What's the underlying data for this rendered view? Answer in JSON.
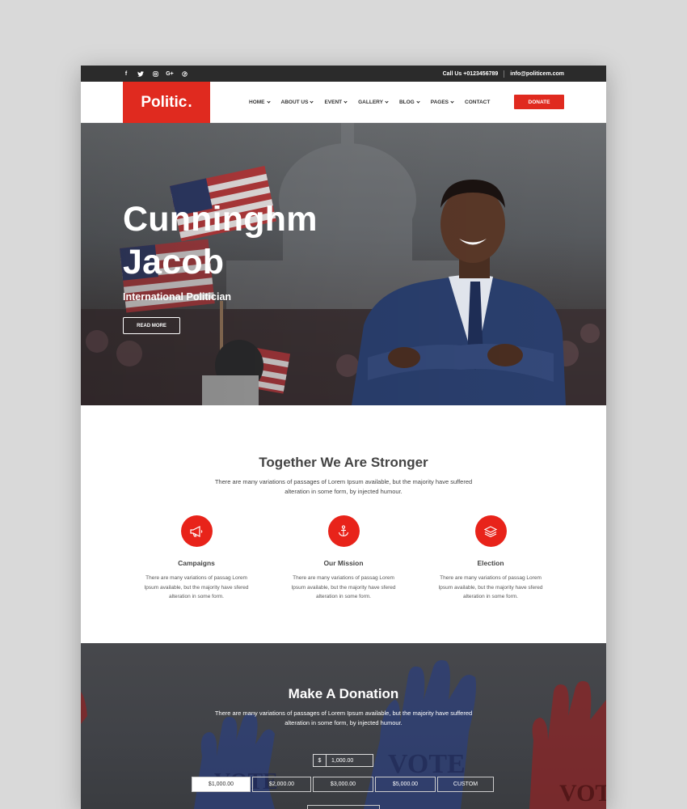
{
  "topbar": {
    "socials": [
      {
        "icon": "facebook-icon",
        "glyph": "f"
      },
      {
        "icon": "twitter-icon",
        "glyph": "t"
      },
      {
        "icon": "instagram-icon",
        "glyph": "◎"
      },
      {
        "icon": "google-plus-icon",
        "glyph": "G+"
      },
      {
        "icon": "pinterest-icon",
        "glyph": "℗"
      }
    ],
    "phone": "Call Us +0123456789",
    "email": "info@politicem.com"
  },
  "header": {
    "logo_text": "Politic",
    "logo_dot": ".",
    "nav": [
      {
        "label": "HOME",
        "dropdown": true
      },
      {
        "label": "ABOUT US",
        "dropdown": true
      },
      {
        "label": "EVENT",
        "dropdown": true
      },
      {
        "label": "GALLERY",
        "dropdown": true
      },
      {
        "label": "BLOG",
        "dropdown": true
      },
      {
        "label": "PAGES",
        "dropdown": true
      },
      {
        "label": "CONTACT",
        "dropdown": false
      }
    ],
    "donate_label": "DONATE"
  },
  "hero": {
    "name_line1": "Cunninghm",
    "name_line2": "Jacob",
    "subtitle": "International Politician",
    "button_label": "READ MORE"
  },
  "about": {
    "title": "Together We Are Stronger",
    "description": "There are many variations of passages of Lorem Ipsum available, but the majority have suffered alteration in some form, by injected humour.",
    "features": [
      {
        "icon": "megaphone-icon",
        "title": "Campaigns",
        "text": "There are many variations of passag Lorem Ipsum available, but the majority have sfered alteration in some form."
      },
      {
        "icon": "anchor-icon",
        "title": "Our Mission",
        "text": "There are many variations of passag Lorem Ipsum available, but the majority have sfered alteration in some form."
      },
      {
        "icon": "layers-icon",
        "title": "Election",
        "text": "There are many variations of passag Lorem Ipsum available, but the majority have sfered alteration in some form."
      }
    ]
  },
  "donation": {
    "title": "Make A Donation",
    "description": "There are many variations of passages of Lorem Ipsum available, but the majority have suffered alteration in some form, by injected humour.",
    "currency": "$",
    "amount": "1,000.00",
    "options": [
      "$1,000.00",
      "$2,000.00",
      "$3,000.00",
      "$5,000.00",
      "CUSTOM"
    ],
    "selected_index": 0,
    "bg_words": [
      "VOTE",
      "VOTE",
      "VOT"
    ]
  },
  "colors": {
    "brand_red": "#e02a1f",
    "topbar": "#2b2b2b",
    "text_dark": "#444444"
  }
}
